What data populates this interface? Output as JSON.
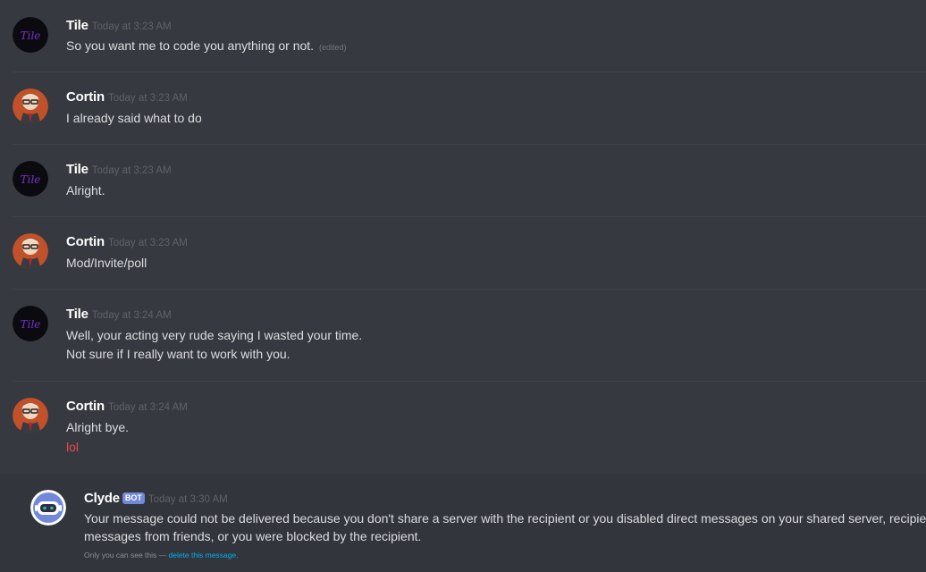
{
  "messages": [
    {
      "user": "Tile",
      "timestamp": "Today at 3:23 AM",
      "lines": [
        "So you want me to code you anything or not."
      ],
      "edited_label": "(edited)"
    },
    {
      "user": "Cortin",
      "timestamp": "Today at 3:23 AM",
      "lines": [
        "I already said what to do"
      ]
    },
    {
      "user": "Tile",
      "timestamp": "Today at 3:23 AM",
      "lines": [
        "Alright."
      ]
    },
    {
      "user": "Cortin",
      "timestamp": "Today at 3:23 AM",
      "lines": [
        "Mod/Invite/poll"
      ]
    },
    {
      "user": "Tile",
      "timestamp": "Today at 3:24 AM",
      "lines": [
        "Well, your acting very rude saying I wasted your time.",
        "Not sure if I really want to work with you."
      ]
    },
    {
      "user": "Cortin",
      "timestamp": "Today at 3:24 AM",
      "lines": [
        "Alright bye.",
        "lol"
      ]
    }
  ],
  "clyde": {
    "user": "Clyde",
    "bot_tag": "BOT",
    "timestamp": "Today at 3:30 AM",
    "lines": [
      "Your message could not be delivered because you don't share a server with the recipient or you disabled direct messages on your shared server, recipient only accepts direct",
      "messages from friends, or you were blocked by the recipient."
    ],
    "ephemeral_note": "Only you can see this — ",
    "delete_link": "delete this message."
  },
  "colors": {
    "background": "#36393f",
    "bot_tag": "#7289da",
    "link": "#00b0f4",
    "red_text": "#f04747"
  },
  "icons": {
    "tile_avatar": "tile-logo-avatar",
    "cortin_avatar": "cartoon-man-glasses-avatar",
    "clyde_avatar": "clyde-robot-avatar"
  }
}
